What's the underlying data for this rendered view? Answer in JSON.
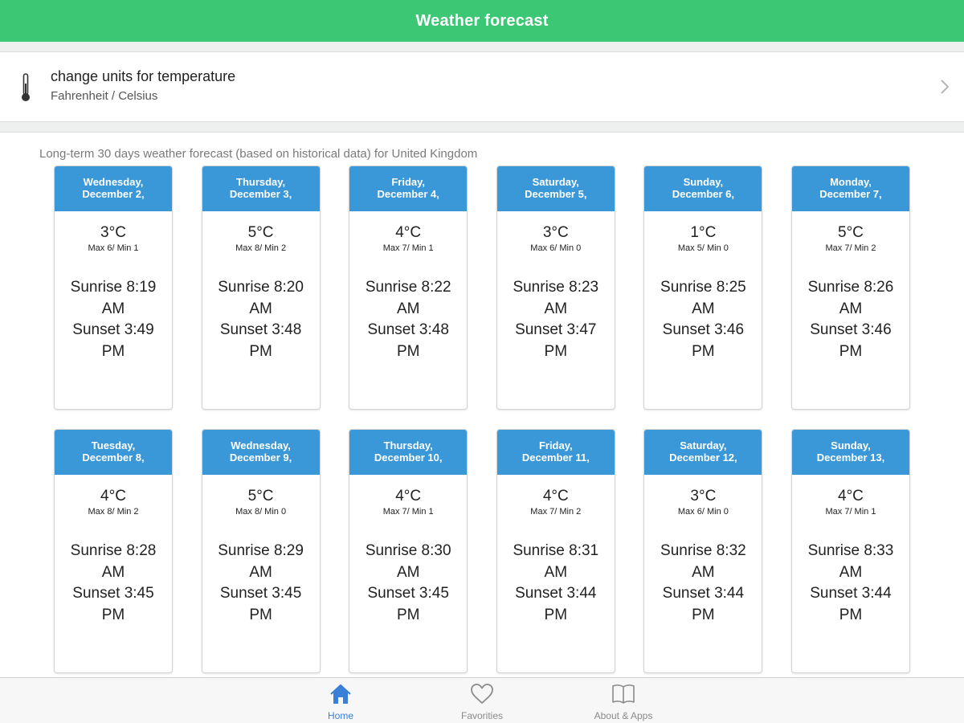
{
  "header": {
    "title": "Weather forecast"
  },
  "units": {
    "title": "change units for temperature",
    "subtitle": "Fahrenheit / Celsius",
    "icon": "thermometer-icon"
  },
  "forecast": {
    "caption": "Long-term 30 days weather forecast (based on historical data) for United Kingdom",
    "days": [
      {
        "day": "Wednesday,",
        "date": "December 2,",
        "temp": "3°C",
        "maxmin": "Max 6/ Min 1",
        "sunrise": "Sunrise 8:19 AM",
        "sunset": "Sunset 3:49 PM"
      },
      {
        "day": "Thursday,",
        "date": "December 3,",
        "temp": "5°C",
        "maxmin": "Max 8/ Min 2",
        "sunrise": "Sunrise 8:20 AM",
        "sunset": "Sunset 3:48 PM"
      },
      {
        "day": "Friday,",
        "date": "December 4,",
        "temp": "4°C",
        "maxmin": "Max 7/ Min 1",
        "sunrise": "Sunrise 8:22 AM",
        "sunset": "Sunset 3:48 PM"
      },
      {
        "day": "Saturday,",
        "date": "December 5,",
        "temp": "3°C",
        "maxmin": "Max 6/ Min 0",
        "sunrise": "Sunrise 8:23 AM",
        "sunset": "Sunset 3:47 PM"
      },
      {
        "day": "Sunday,",
        "date": "December 6,",
        "temp": "1°C",
        "maxmin": "Max 5/ Min 0",
        "sunrise": "Sunrise 8:25 AM",
        "sunset": "Sunset 3:46 PM"
      },
      {
        "day": "Monday,",
        "date": "December 7,",
        "temp": "5°C",
        "maxmin": "Max 7/ Min 2",
        "sunrise": "Sunrise 8:26 AM",
        "sunset": "Sunset 3:46 PM"
      },
      {
        "day": "Tuesday,",
        "date": "December 8,",
        "temp": "4°C",
        "maxmin": "Max 8/ Min 2",
        "sunrise": "Sunrise 8:28 AM",
        "sunset": "Sunset 3:45 PM"
      },
      {
        "day": "Wednesday,",
        "date": "December 9,",
        "temp": "5°C",
        "maxmin": "Max 8/ Min 0",
        "sunrise": "Sunrise 8:29 AM",
        "sunset": "Sunset 3:45 PM"
      },
      {
        "day": "Thursday,",
        "date": "December 10,",
        "temp": "4°C",
        "maxmin": "Max 7/ Min 1",
        "sunrise": "Sunrise 8:30 AM",
        "sunset": "Sunset 3:45 PM"
      },
      {
        "day": "Friday,",
        "date": "December 11,",
        "temp": "4°C",
        "maxmin": "Max 7/ Min 2",
        "sunrise": "Sunrise 8:31 AM",
        "sunset": "Sunset 3:44 PM"
      },
      {
        "day": "Saturday,",
        "date": "December 12,",
        "temp": "3°C",
        "maxmin": "Max 6/ Min 0",
        "sunrise": "Sunrise 8:32 AM",
        "sunset": "Sunset 3:44 PM"
      },
      {
        "day": "Sunday,",
        "date": "December 13,",
        "temp": "4°C",
        "maxmin": "Max 7/ Min 1",
        "sunrise": "Sunrise 8:33 AM",
        "sunset": "Sunset 3:44 PM"
      }
    ]
  },
  "tabbar": {
    "items": [
      {
        "label": "Home",
        "icon": "home-icon",
        "active": true
      },
      {
        "label": "Favorities",
        "icon": "heart-icon",
        "active": false
      },
      {
        "label": "About & Apps",
        "icon": "book-icon",
        "active": false
      }
    ]
  },
  "colors": {
    "header_bg": "#3cc775",
    "card_header_bg": "#3a98d8",
    "active_tab": "#3a7fd8",
    "inactive_tab": "#8a8a8a"
  }
}
